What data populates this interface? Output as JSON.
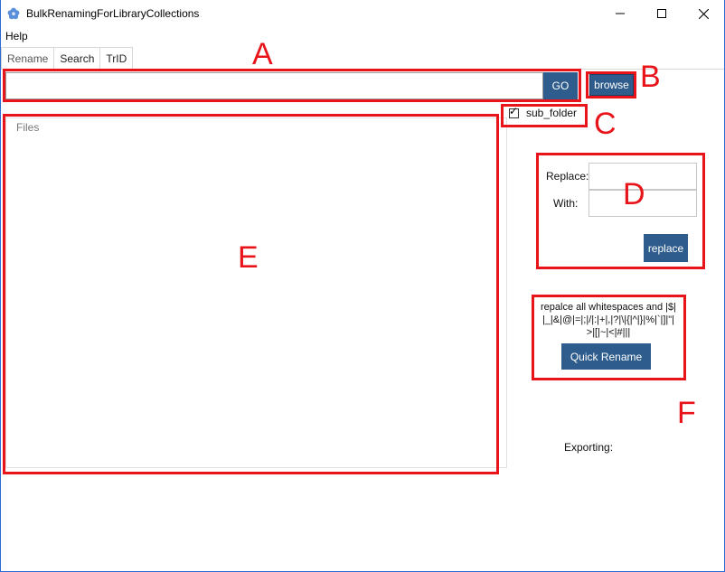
{
  "window": {
    "title": "BulkRenamingForLibraryCollections",
    "minimize_glyph": "—",
    "maximize_glyph": "☐",
    "close_glyph": "✕"
  },
  "menu": {
    "help": "Help"
  },
  "tabs": [
    {
      "label": "Rename"
    },
    {
      "label": "Search"
    },
    {
      "label": "TrID"
    }
  ],
  "path_bar": {
    "value": "",
    "go_label": "GO",
    "browse_label": "browse"
  },
  "sub_folder": {
    "label": "sub_folder",
    "checked": true
  },
  "files": {
    "label": "Files"
  },
  "replace_panel": {
    "replace_label": "Replace:",
    "with_label": "With:",
    "replace_value": "",
    "with_value": "",
    "button_label": "replace"
  },
  "quick_rename": {
    "description": "repalce all whitespaces and |$||_|&|@|=|;|/|:|+|,|?|\\|{|^|}|%|`|]|\"|>|[|~|<|#|||",
    "button_label": "Quick Rename"
  },
  "status": {
    "exporting_label": "Exporting:"
  },
  "annotations": [
    {
      "letter": "A"
    },
    {
      "letter": "B"
    },
    {
      "letter": "C"
    },
    {
      "letter": "D"
    },
    {
      "letter": "E"
    },
    {
      "letter": "F"
    }
  ],
  "colors": {
    "button_bg": "#2e5c8c",
    "annotation_red": "#e8141a",
    "window_border": "#2a6bd6",
    "app_icon": "#5b8fd9"
  },
  "icons": {
    "app": "app-flower-icon",
    "checkmark": "checkmark-icon"
  }
}
